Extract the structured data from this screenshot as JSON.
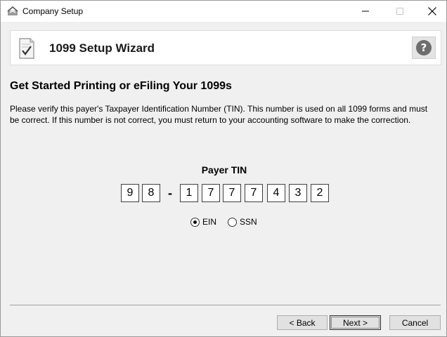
{
  "window": {
    "title": "Company Setup",
    "icons": {
      "app": "company-setup-app-icon",
      "minimize": "minimize-icon",
      "maximize": "maximize-icon",
      "close": "close-icon"
    }
  },
  "header": {
    "title": "1099 Setup Wizard",
    "icons": {
      "document": "document-checkmark-icon",
      "help": "help-icon"
    },
    "help_glyph": "?"
  },
  "main": {
    "heading": "Get Started Printing or eFiling Your 1099s",
    "description": "Please verify this payer's Taxpayer Identification Number (TIN). This number is used on all 1099 forms and must be correct. If this number is not correct, you must return to your accounting software to make the correction.",
    "tin": {
      "label": "Payer TIN",
      "prefix": [
        "9",
        "8"
      ],
      "separator": "-",
      "suffix": [
        "1",
        "7",
        "7",
        "7",
        "4",
        "3",
        "2"
      ]
    },
    "tin_type": {
      "options": [
        {
          "label": "EIN",
          "selected": true
        },
        {
          "label": "SSN",
          "selected": false
        }
      ]
    }
  },
  "footer": {
    "back_label": "< Back",
    "next_label": "Next >",
    "cancel_label": "Cancel"
  }
}
